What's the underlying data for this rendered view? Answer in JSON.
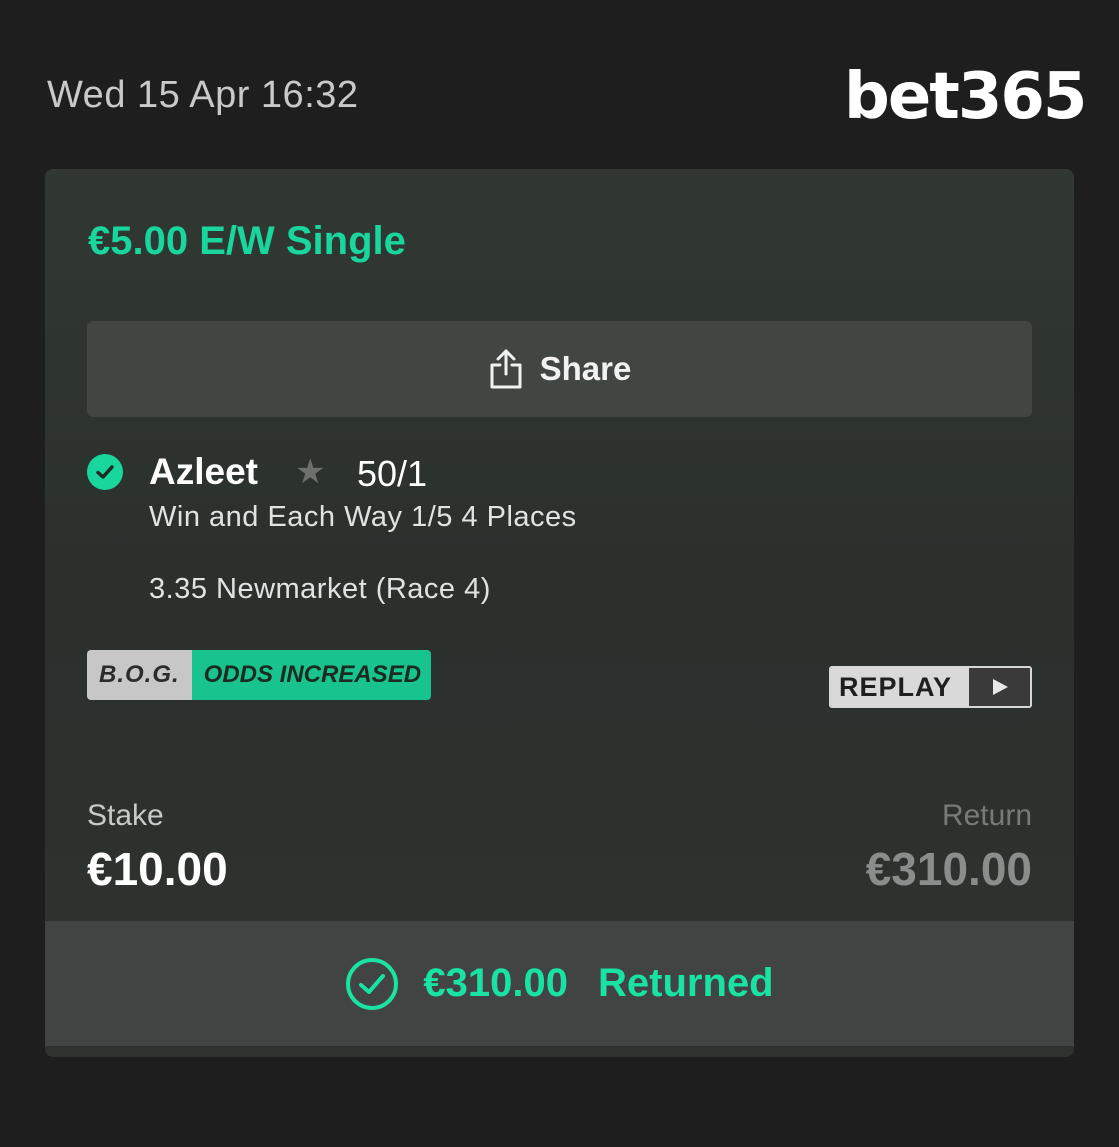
{
  "header": {
    "datetime": "Wed 15 Apr 16:32",
    "brand": "bet365"
  },
  "bet": {
    "title": "€5.00 E/W Single",
    "share_label": "Share",
    "selection": {
      "name": "Azleet",
      "odds": "50/1",
      "market": "Win and Each Way 1/5 4 Places",
      "event": "3.35 Newmarket (Race 4)",
      "icons": [
        "check-circle-icon",
        "star-icon"
      ]
    },
    "badges": {
      "bog": "B.O.G.",
      "odds_increased": "ODDS INCREASED"
    },
    "replay_label": "REPLAY",
    "stake_label": "Stake",
    "stake_value": "€10.00",
    "return_label": "Return",
    "return_value": "€310.00",
    "result": {
      "amount": "€310.00",
      "status": "Returned"
    }
  },
  "colors": {
    "accent": "#18d69c",
    "background": "#1e1e1e",
    "card": "#2f3430",
    "button": "#424643"
  }
}
